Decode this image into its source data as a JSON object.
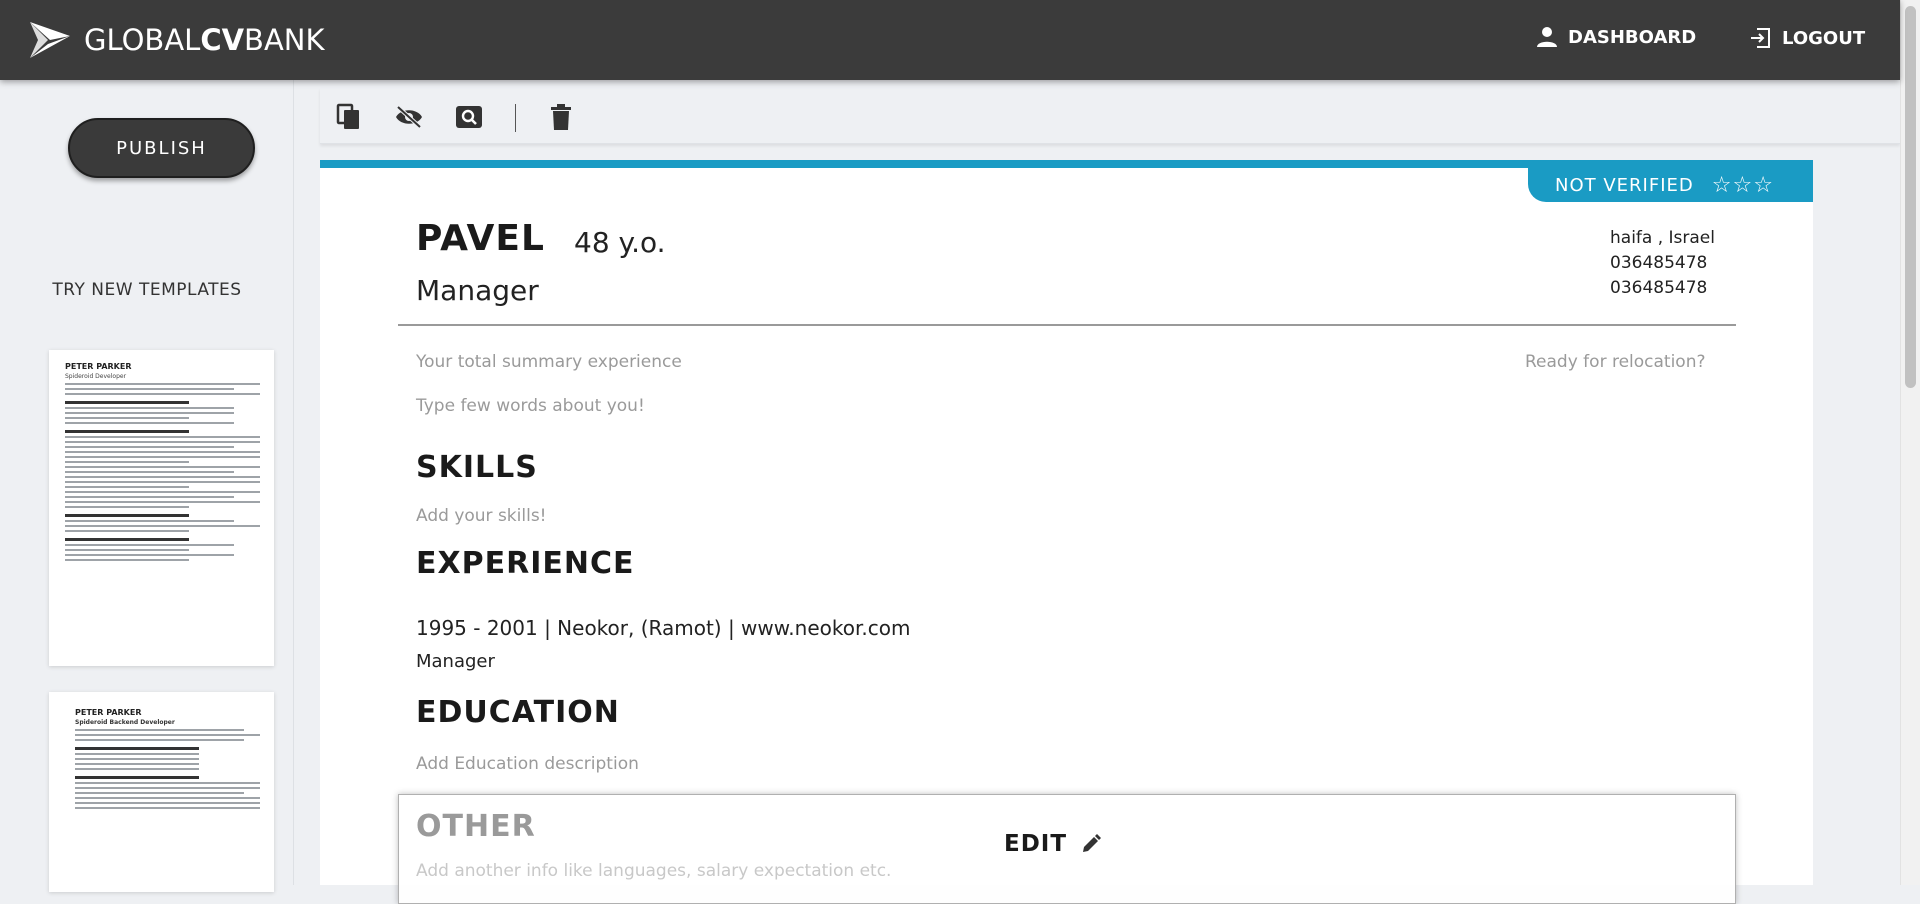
{
  "header": {
    "logo_light": "GLOBAL",
    "logo_bold": "CV",
    "logo_light2": "BANK",
    "dashboard_label": "DASHBOARD",
    "logout_label": "LOGOUT"
  },
  "sidebar": {
    "publish_label": "PUBLISH",
    "try_templates_label": "TRY NEW TEMPLATES",
    "templates": [
      {
        "name": "PETER PARKER",
        "role": "Spideroid Developer"
      },
      {
        "name": "PETER PARKER",
        "role": "Spideroid Backend Developer"
      }
    ]
  },
  "toolbar": {
    "icons": [
      "copy-icon",
      "hide-icon",
      "preview-icon",
      "delete-icon"
    ]
  },
  "cv": {
    "status": "NOT VERIFIED",
    "stars": "☆☆☆",
    "rating": 0,
    "rating_max": 3,
    "name": "PAVEL",
    "age": "48 y.o.",
    "role": "Manager",
    "location": "haifa , Israel",
    "phone1": "036485478",
    "phone2": "036485478",
    "summary_placeholder": "Your total summary experience",
    "relocation_placeholder": "Ready for relocation?",
    "about_placeholder": "Type few words about you!",
    "skills_heading": "SKILLS",
    "skills_placeholder": "Add your skills!",
    "experience_heading": "EXPERIENCE",
    "experience": {
      "line": "1995 - 2001 | Neokor, (Ramot) | www.neokor.com",
      "role": "Manager"
    },
    "education_heading": "EDUCATION",
    "education_placeholder": "Add Education description",
    "other_heading": "OTHER",
    "other_placeholder": "Add another info like languages, salary expectation etc.",
    "edit_label": "EDIT"
  },
  "colors": {
    "header_bg": "#3b3b3b",
    "accent": "#1a9bc4",
    "muted_text": "#9a9a9a"
  }
}
